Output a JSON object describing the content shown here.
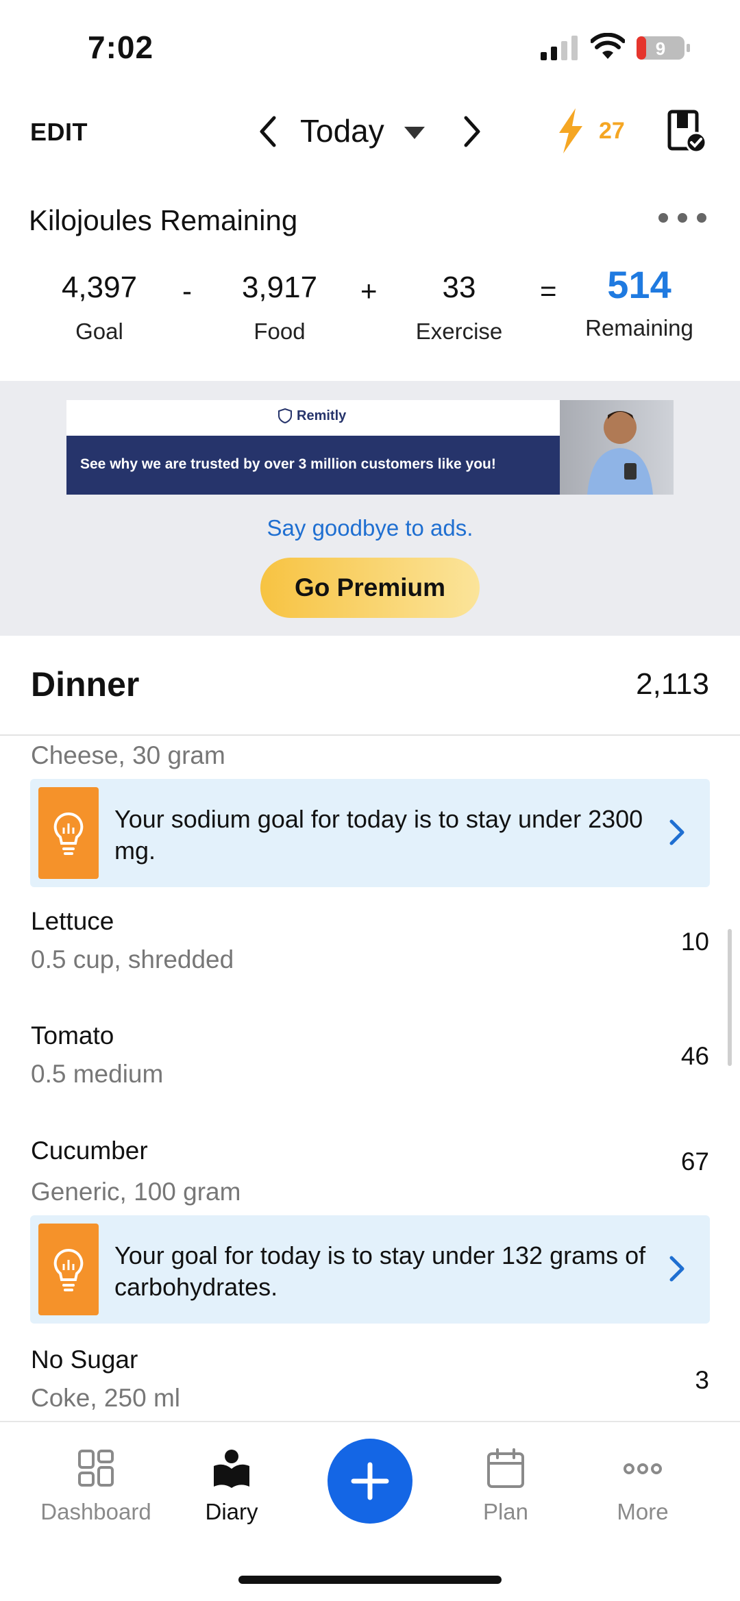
{
  "status_bar": {
    "time": "7:02",
    "battery": "9"
  },
  "topnav": {
    "edit_label": "EDIT",
    "date_label": "Today",
    "streak_count": "27"
  },
  "summary": {
    "title": "Kilojoules Remaining",
    "goal_value": "4,397",
    "goal_label": "Goal",
    "op_minus": "-",
    "food_value": "3,917",
    "food_label": "Food",
    "op_plus": "+",
    "exercise_value": "33",
    "exercise_label": "Exercise",
    "op_equals": "=",
    "remaining_value": "514",
    "remaining_label": "Remaining"
  },
  "ad": {
    "brand": "Remitly",
    "text": "See why we are trusted by over 3 million customers like you!",
    "goodbye": "Say goodbye to ads.",
    "premium_label": "Go Premium"
  },
  "dinner": {
    "title": "Dinner",
    "total": "2,113",
    "items": [
      {
        "detail": "Cheese, 30 gram"
      },
      {
        "name": "Lettuce",
        "detail": "0.5 cup, shredded",
        "value": "10"
      },
      {
        "name": "Tomato",
        "detail": "0.5 medium",
        "value": "46"
      },
      {
        "name": "Cucumber",
        "detail": "Generic, 100 gram",
        "value": "67"
      },
      {
        "name": "No Sugar",
        "detail": "Coke, 250 ml",
        "value": "3"
      }
    ],
    "tips": [
      {
        "text": "Your sodium goal for today is to stay under 2300 mg."
      },
      {
        "text": "Your goal for today is to stay under 132 grams of carbohydrates."
      }
    ]
  },
  "tabbar": {
    "dashboard": "Dashboard",
    "diary": "Diary",
    "plan": "Plan",
    "more": "More"
  },
  "colors": {
    "accent_blue": "#1466e5",
    "remaining_blue": "#1f7ae0",
    "streak_orange": "#f5a623",
    "tip_bg": "#e3f1fb",
    "tip_icon_bg": "#f5922a"
  }
}
